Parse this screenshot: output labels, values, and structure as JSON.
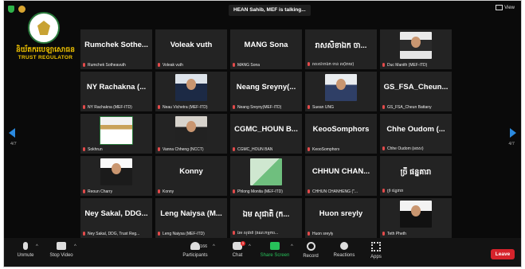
{
  "window": {
    "talking_banner": "HEAN Sahib, MEF is talking...",
    "view_label": "View"
  },
  "logo": {
    "khmer_text": "និយ័តករបេឡាសោធន",
    "english_text": "TRUST REGULATOR"
  },
  "pagination": {
    "left": "4/7",
    "right": "4/7"
  },
  "tiles": [
    {
      "name": "Rumchek Sothe...",
      "label": "Rumchek Sotheavuth",
      "video": false
    },
    {
      "name": "Voleak vuth",
      "label": "Voleak vuth",
      "video": false
    },
    {
      "name": "MANG Sona",
      "label": "MANG Sona",
      "video": false
    },
    {
      "name": "រាសសិខាឯក ចា...",
      "label": "រាសសិខាឯក ចាន់ ល(ងាយ)",
      "video": false
    },
    {
      "name": "",
      "label": "Duc Manith (MEF-ITD)",
      "video": true,
      "style": "v1"
    },
    {
      "name": "NY Rachakna (...",
      "label": "NY Rachakna (MEF-ITD)",
      "video": false
    },
    {
      "name": "",
      "label": "Neau Vichetra (MEF-ITD)",
      "video": true,
      "style": "v2"
    },
    {
      "name": "Neang Sreyny(...",
      "label": "Neang Sreyny(MEF-ITD)",
      "video": false
    },
    {
      "name": "",
      "label": "Suean UNG",
      "video": true,
      "style": "v3"
    },
    {
      "name": "GS_FSA_Cheun...",
      "label": "GS_FSA_Cheun Battany",
      "video": false
    },
    {
      "name": "",
      "label": "Sokhrun",
      "video": true,
      "style": "v4"
    },
    {
      "name": "",
      "label": "Vanna Chheng (NCCT)",
      "video": true,
      "style": "v5"
    },
    {
      "name": "CGMC_HOUN B...",
      "label": "CGMC_HOUN BAN",
      "video": false
    },
    {
      "name": "KeooSomphors",
      "label": "KeooSomphors",
      "video": false
    },
    {
      "name": "Chhe Oudom (...",
      "label": "Chhe Oudom (អគស)",
      "video": false
    },
    {
      "name": "",
      "label": "Reoun Charry",
      "video": true,
      "style": "v6"
    },
    {
      "name": "Konny",
      "label": "Konny",
      "video": false
    },
    {
      "name": "",
      "label": "Phlong Monita (MEF-ITD)",
      "video": true,
      "style": "v7"
    },
    {
      "name": "CHHUN CHAN...",
      "label": "CHHUN CHANHENG (\"...",
      "video": false
    },
    {
      "name": "ច្រី ផន្នគារា",
      "label": "ច្រី ផន្នគារា",
      "video": false
    },
    {
      "name": "Ney Sakal, DDG...",
      "label": "Ney Sakal, DDG, Trust Reg...",
      "video": false
    },
    {
      "name": "Leng Naiysa (M...",
      "label": "Leng Naiysa (MEF-ITD)",
      "video": false
    },
    {
      "name": "ឯម សុជាតិ (ក...",
      "label": "ឯម សុជាតិ (គណៈកម្មការ...",
      "video": false
    },
    {
      "name": "Huon sreyly",
      "label": "Huon sreyly",
      "video": false
    },
    {
      "name": "",
      "label": "Teth Pheth",
      "video": true,
      "style": "v8"
    }
  ],
  "toolbar": {
    "unmute": "Unmute",
    "stop_video": "Stop Video",
    "participants": "Participants",
    "participants_count": "166",
    "chat": "Chat",
    "chat_badge": "1",
    "share_screen": "Share Screen",
    "record": "Record",
    "reactions": "Reactions",
    "apps": "Apps",
    "leave": "Leave"
  },
  "colors": {
    "share_green": "#27c25a",
    "leave_red": "#d6232b",
    "logo_gold": "#f0c300",
    "arrow_blue": "#2b8ae0"
  }
}
